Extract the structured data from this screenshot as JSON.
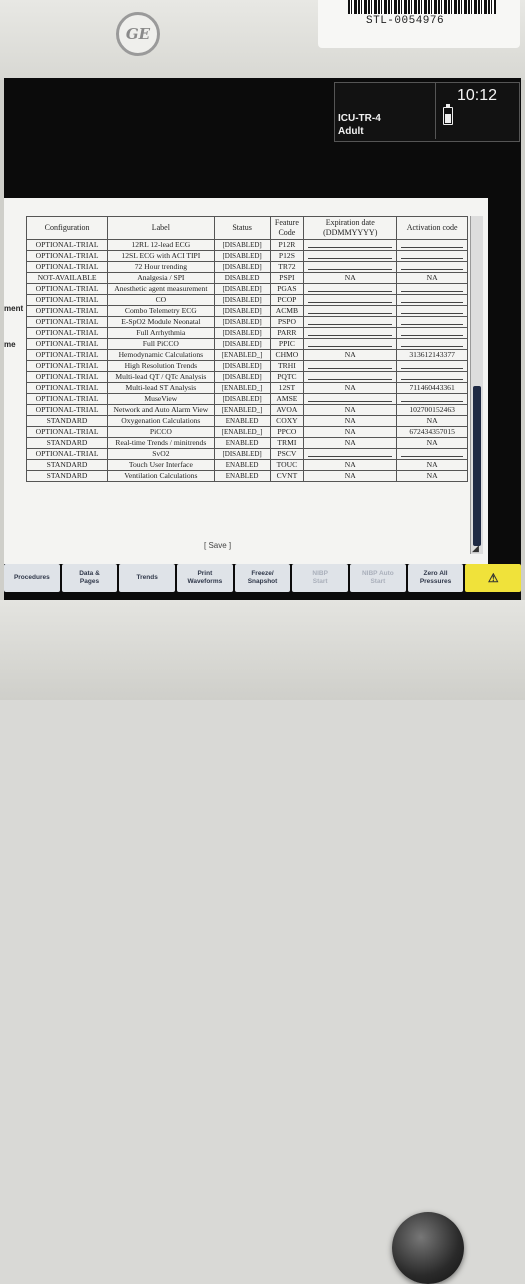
{
  "device": {
    "brand": "GE",
    "asset_tag": "STL-0054976"
  },
  "status": {
    "bed_name": "ICU-TR-4",
    "patient_type": "Adult",
    "time": "10:12"
  },
  "side_labels": [
    "ment",
    "me"
  ],
  "table": {
    "headers": [
      "Configuration",
      "Label",
      "Status",
      "Feature Code",
      "Expiration date (DDMMYYYY)",
      "Activation code"
    ],
    "rows": [
      {
        "config": "OPTIONAL-TRIAL",
        "label": "12RL 12-lead ECG",
        "status": "[DISABLED]",
        "code": "P12R",
        "exp": "",
        "act": ""
      },
      {
        "config": "OPTIONAL-TRIAL",
        "label": "12SL ECG with ACI TIPI",
        "status": "[DISABLED]",
        "code": "P12S",
        "exp": "",
        "act": ""
      },
      {
        "config": "OPTIONAL-TRIAL",
        "label": "72 Hour trending",
        "status": "[DISABLED]",
        "code": "TR72",
        "exp": "",
        "act": ""
      },
      {
        "config": "NOT-AVAILABLE",
        "label": "Analgesia / SPI",
        "status": "DISABLED",
        "code": "PSPI",
        "exp": "NA",
        "act": "NA"
      },
      {
        "config": "OPTIONAL-TRIAL",
        "label": "Anesthetic agent measurement",
        "status": "[DISABLED]",
        "code": "PGAS",
        "exp": "",
        "act": "",
        "tall": true
      },
      {
        "config": "OPTIONAL-TRIAL",
        "label": "CO",
        "status": "[DISABLED]",
        "code": "PCOP",
        "exp": "",
        "act": ""
      },
      {
        "config": "OPTIONAL-TRIAL",
        "label": "Combo Telemetry ECG",
        "status": "[DISABLED]",
        "code": "ACMB",
        "exp": "",
        "act": ""
      },
      {
        "config": "OPTIONAL-TRIAL",
        "label": "E-SpO2 Module Neonatal",
        "status": "[DISABLED]",
        "code": "PSPO",
        "exp": "",
        "act": ""
      },
      {
        "config": "OPTIONAL-TRIAL",
        "label": "Full Arrhythmia",
        "status": "[DISABLED]",
        "code": "PARR",
        "exp": "",
        "act": ""
      },
      {
        "config": "OPTIONAL-TRIAL",
        "label": "Full PiCCO",
        "status": "[DISABLED]",
        "code": "PPIC",
        "exp": "",
        "act": ""
      },
      {
        "config": "OPTIONAL-TRIAL",
        "label": "Hemodynamic Calculations",
        "status": "[ENABLED_]",
        "code": "CHMO",
        "exp": "NA",
        "act": "313612143377",
        "tall": true
      },
      {
        "config": "OPTIONAL-TRIAL",
        "label": "High Resolution Trends",
        "status": "[DISABLED]",
        "code": "TRHI",
        "exp": "",
        "act": ""
      },
      {
        "config": "OPTIONAL-TRIAL",
        "label": "Multi-lead QT / QTc Analysis",
        "status": "[DISABLED]",
        "code": "PQTC",
        "exp": "",
        "act": "",
        "tall": true
      },
      {
        "config": "OPTIONAL-TRIAL",
        "label": "Multi-lead ST Analysis",
        "status": "[ENABLED_]",
        "code": "12ST",
        "exp": "NA",
        "act": "711460443361"
      },
      {
        "config": "OPTIONAL-TRIAL",
        "label": "MuseView",
        "status": "[DISABLED]",
        "code": "AMSE",
        "exp": "",
        "act": ""
      },
      {
        "config": "OPTIONAL-TRIAL",
        "label": "Network and Auto Alarm View",
        "status": "[ENABLED_]",
        "code": "AVOA",
        "exp": "NA",
        "act": "102700152463",
        "tall": true
      },
      {
        "config": "STANDARD",
        "label": "Oxygenation Calculations",
        "status": "ENABLED",
        "code": "COXY",
        "exp": "NA",
        "act": "NA"
      },
      {
        "config": "OPTIONAL-TRIAL",
        "label": "PiCCO",
        "status": "[ENABLED_]",
        "code": "PPCO",
        "exp": "NA",
        "act": "672434357015"
      },
      {
        "config": "STANDARD",
        "label": "Real-time Trends / minitrends",
        "status": "ENABLED",
        "code": "TRMI",
        "exp": "NA",
        "act": "NA",
        "tall": true
      },
      {
        "config": "OPTIONAL-TRIAL",
        "label": "SvO2",
        "status": "[DISABLED]",
        "code": "PSCV",
        "exp": "",
        "act": ""
      },
      {
        "config": "STANDARD",
        "label": "Touch User Interface",
        "status": "ENABLED",
        "code": "TOUC",
        "exp": "NA",
        "act": "NA"
      },
      {
        "config": "STANDARD",
        "label": "Ventilation Calculations",
        "status": "ENABLED",
        "code": "CVNT",
        "exp": "NA",
        "act": "NA"
      }
    ],
    "save_label": "[ Save ]"
  },
  "menu": [
    {
      "label": "Procedures",
      "disabled": false
    },
    {
      "label": "Data &\nPages",
      "disabled": false
    },
    {
      "label": "Trends",
      "disabled": false
    },
    {
      "label": "Print\nWaveforms",
      "disabled": false
    },
    {
      "label": "Freeze/\nSnapshot",
      "disabled": false
    },
    {
      "label": "NIBP\nStart",
      "disabled": true
    },
    {
      "label": "NIBP Auto\nStart",
      "disabled": true
    },
    {
      "label": "Zero All\nPressures",
      "disabled": false
    }
  ],
  "alarm_button_icon": "alarm-bell-icon"
}
